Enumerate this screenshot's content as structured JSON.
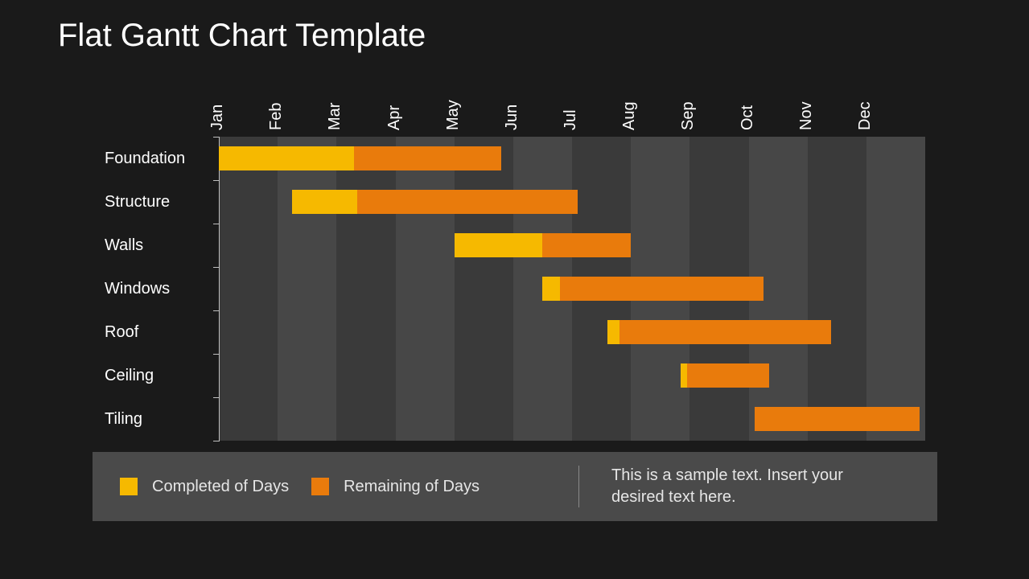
{
  "title": "Flat Gantt Chart Template",
  "legend": {
    "completed": "Completed of Days",
    "remaining": "Remaining of Days",
    "sample_text": "This is a sample text. Insert your desired text here."
  },
  "colors": {
    "completed": "#f6b900",
    "remaining": "#e97b0c",
    "bg": "#1a1a1a",
    "stripe_a": "#3a3a3a",
    "stripe_b": "#474747",
    "legend_bg": "#4a4a4a"
  },
  "chart_data": {
    "type": "bar",
    "title": "Flat Gantt Chart Template",
    "xlabel": "",
    "ylabel": "",
    "categories": [
      "Jan",
      "Feb",
      "Mar",
      "Apr",
      "May",
      "Jun",
      "Jul",
      "Aug",
      "Sep",
      "Oct",
      "Nov",
      "Dec"
    ],
    "series": [
      {
        "name": "Foundation",
        "start": 0.0,
        "completed": 2.3,
        "remaining": 2.5
      },
      {
        "name": "Structure",
        "start": 1.25,
        "completed": 1.1,
        "remaining": 3.75
      },
      {
        "name": "Walls",
        "start": 4.0,
        "completed": 1.5,
        "remaining": 1.5
      },
      {
        "name": "Windows",
        "start": 5.5,
        "completed": 0.3,
        "remaining": 3.45
      },
      {
        "name": "Roof",
        "start": 6.6,
        "completed": 0.2,
        "remaining": 3.6
      },
      {
        "name": "Ceiling",
        "start": 7.85,
        "completed": 0.1,
        "remaining": 1.4
      },
      {
        "name": "Tiling",
        "start": 9.1,
        "completed": 0.0,
        "remaining": 2.8
      }
    ],
    "xlim": [
      0,
      12
    ],
    "legend": [
      "Completed of Days",
      "Remaining of Days"
    ]
  }
}
